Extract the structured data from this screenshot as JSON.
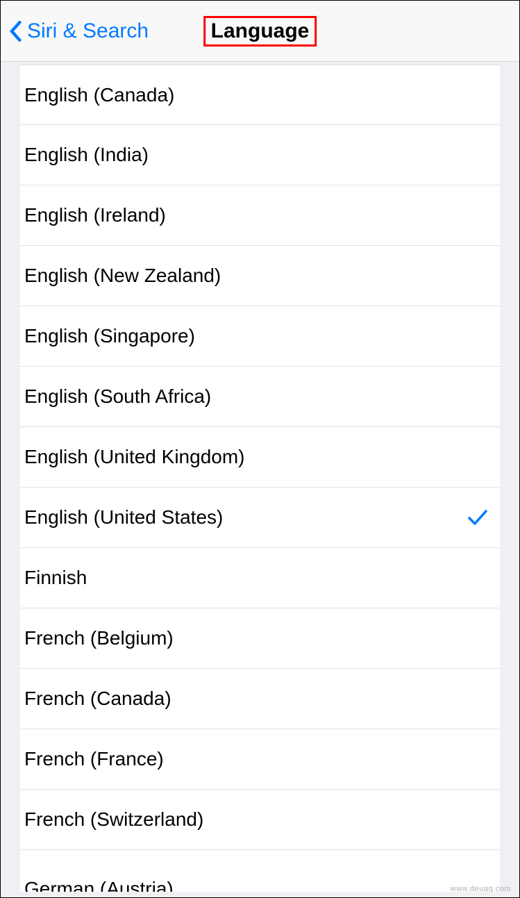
{
  "header": {
    "back_label": "Siri & Search",
    "title": "Language"
  },
  "languages": [
    {
      "label": "English (Canada)",
      "selected": false
    },
    {
      "label": "English (India)",
      "selected": false
    },
    {
      "label": "English (Ireland)",
      "selected": false
    },
    {
      "label": "English (New Zealand)",
      "selected": false
    },
    {
      "label": "English (Singapore)",
      "selected": false
    },
    {
      "label": "English (South Africa)",
      "selected": false
    },
    {
      "label": "English (United Kingdom)",
      "selected": false
    },
    {
      "label": "English (United States)",
      "selected": true
    },
    {
      "label": "Finnish",
      "selected": false
    },
    {
      "label": "French (Belgium)",
      "selected": false
    },
    {
      "label": "French (Canada)",
      "selected": false
    },
    {
      "label": "French (France)",
      "selected": false
    },
    {
      "label": "French (Switzerland)",
      "selected": false
    },
    {
      "label": "German (Austria)",
      "selected": false
    }
  ],
  "watermark": "www.deuaq.com"
}
